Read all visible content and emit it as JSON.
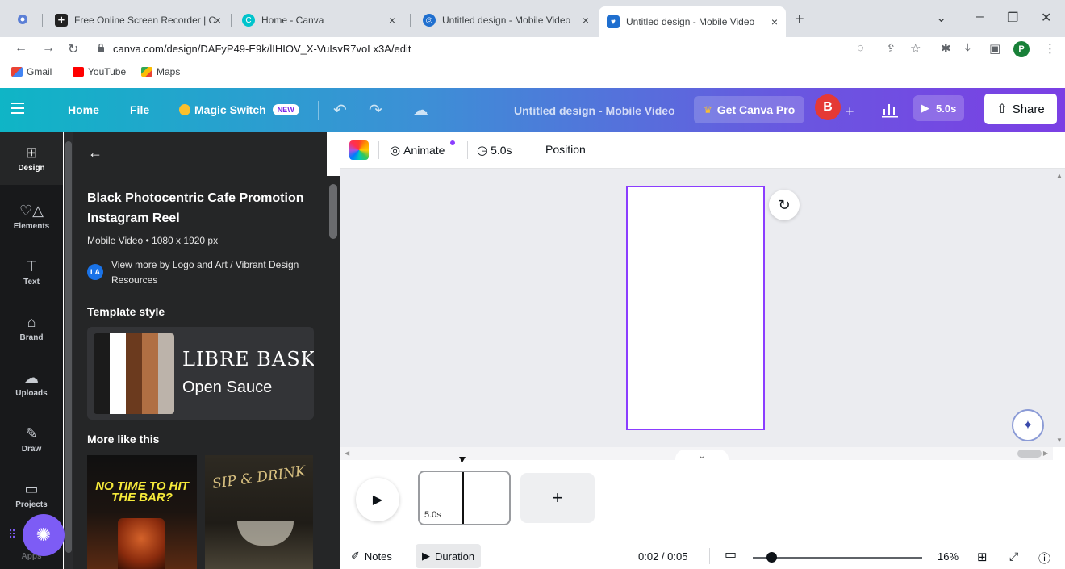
{
  "browser": {
    "tabs": [
      {
        "title": "Free Online Screen Recorder | O",
        "close": "×"
      },
      {
        "title": "Home - Canva",
        "close": "×"
      },
      {
        "title": "Untitled design - Mobile Video",
        "close": "×"
      },
      {
        "title": "Untitled design - Mobile Video",
        "close": "×",
        "active": true
      }
    ],
    "new_tab": "+",
    "window_controls": {
      "dropdown": "⌄",
      "minimize": "–",
      "restore": "❐",
      "close": "✕"
    },
    "url": "canva.com/design/DAFyP49-E9k/lIHIOV_X-VuIsvR7voLx3A/edit",
    "profile_initial": "P",
    "bookmarks": [
      "Gmail",
      "YouTube",
      "Maps"
    ]
  },
  "canva_bar": {
    "home": "Home",
    "file": "File",
    "magic_switch": "Magic Switch",
    "new_badge": "NEW",
    "design_title": "Untitled design - Mobile Video",
    "get_pro": "Get Canva Pro",
    "avatar_initial": "B",
    "plus": "+",
    "play_duration": "5.0s",
    "share": "Share"
  },
  "rail": {
    "items": [
      {
        "label": "Design",
        "icon": "⊞"
      },
      {
        "label": "Elements",
        "icon": "♡△"
      },
      {
        "label": "Text",
        "icon": "T"
      },
      {
        "label": "Brand",
        "icon": "⌂"
      },
      {
        "label": "Uploads",
        "icon": "☁"
      },
      {
        "label": "Draw",
        "icon": "✎"
      },
      {
        "label": "Projects",
        "icon": "▭"
      },
      {
        "label": "Apps",
        "icon": "⁘"
      }
    ]
  },
  "panel": {
    "back": "←",
    "template_title": "Black Photocentric Cafe Promotion Instagram Reel",
    "template_meta": "Mobile Video • 1080 x 1920 px",
    "author_initials": "LA",
    "author_line": "View more by Logo and Art / Vibrant Design Resources",
    "template_style_heading": "Template style",
    "font_heading": "LIBRE BASKERVILLE",
    "font_body": "Open Sauce",
    "palette": [
      "#1b1b1b",
      "#ffffff",
      "#6b3a1e",
      "#b06f43",
      "#bcb3aa"
    ],
    "more_heading": "More like this",
    "thumb1_text": "NO TIME TO HIT THE BAR?",
    "thumb2_text": "SIP & DRINK"
  },
  "editor_toolbar": {
    "animate": "Animate",
    "duration": "5.0s",
    "position": "Position"
  },
  "timeline": {
    "clip_duration": "5.0s",
    "add": "+"
  },
  "bottom_bar": {
    "notes": "Notes",
    "duration": "Duration",
    "timecode": "0:02 / 0:05",
    "zoom": "16%",
    "zoom_level": 0.16
  }
}
